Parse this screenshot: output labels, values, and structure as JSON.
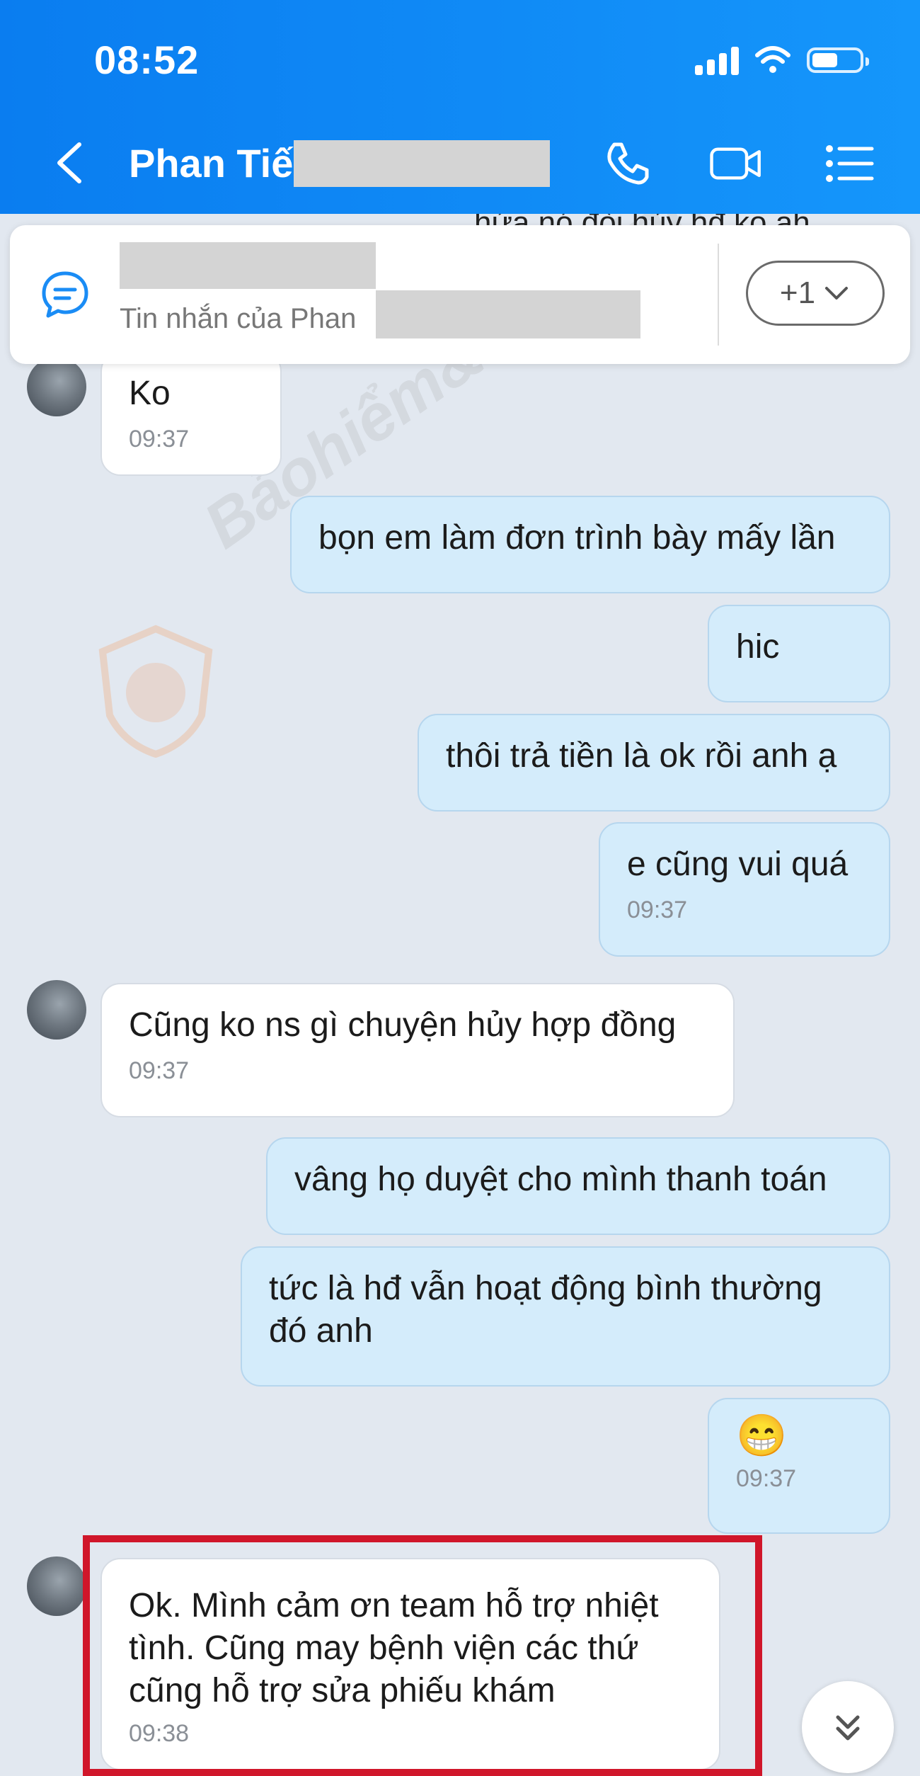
{
  "status_bar": {
    "time": "08:52"
  },
  "header": {
    "contact_name": "Phan Tiế"
  },
  "pinned": {
    "peek_text": "hứa nó đòi hủy hđ ko ah",
    "subtitle": "Tin nhắn của Phan",
    "more_count": "+1"
  },
  "watermark": "Bảohiểm&Tàichính",
  "messages": [
    {
      "dir": "in",
      "text": "Ko",
      "time": "09:37"
    },
    {
      "dir": "out",
      "text": "bọn em làm đơn trình bày mấy lần",
      "time": ""
    },
    {
      "dir": "out",
      "text": "hic",
      "time": ""
    },
    {
      "dir": "out",
      "text": "thôi trả tiền là ok rồi anh ạ",
      "time": ""
    },
    {
      "dir": "out",
      "text": "e cũng vui quá",
      "time": "09:37"
    },
    {
      "dir": "in",
      "text": "Cũng ko ns gì chuyện hủy hợp đồng",
      "time": "09:37"
    },
    {
      "dir": "out",
      "text": "vâng họ duyệt cho mình thanh toán",
      "time": ""
    },
    {
      "dir": "out",
      "text": "tức là hđ vẫn hoạt động bình thường đó anh",
      "time": ""
    },
    {
      "dir": "out",
      "text": "😁",
      "time": "09:37"
    },
    {
      "dir": "in",
      "text": "Ok. Mình cảm ơn team hỗ trợ nhiệt tình. Cũng may bệnh viện các thứ cũng hỗ trợ sửa phiếu khám",
      "time": "09:38"
    }
  ],
  "colors": {
    "header_blue": "#0a7df0",
    "outgoing_bubble": "#d4ecfb",
    "incoming_bubble": "#ffffff",
    "highlight": "#d0162a"
  },
  "icons": [
    "back-icon",
    "phone-icon",
    "video-icon",
    "menu-icon",
    "message-icon",
    "chevron-down-icon",
    "double-chevron-down-icon"
  ]
}
